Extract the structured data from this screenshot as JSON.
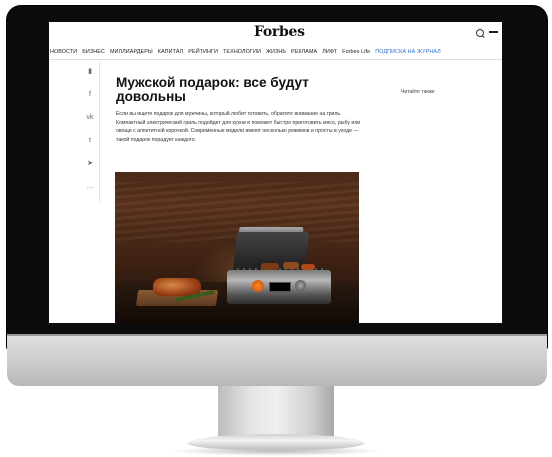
{
  "site": {
    "logo": "Forbes"
  },
  "nav": {
    "items": [
      "НОВОСТИ",
      "БИЗНЕС",
      "МИЛЛИАРДЕРЫ",
      "КАПИТАЛ",
      "РЕЙТИНГИ",
      "ТЕХНОЛОГИИ",
      "ЖИЗНЬ",
      "РЕКЛАМА",
      "ЛИФТ"
    ],
    "special": "Forbes Life",
    "link": "ПОДПИСКА НА ЖУРНАЛ"
  },
  "share_icons": [
    "bookmark-icon",
    "facebook-icon",
    "vk-icon",
    "twitter-icon",
    "telegram-icon",
    "more-icon"
  ],
  "share_glyphs": [
    "▮",
    "f",
    "vk",
    "t",
    "➤",
    "…"
  ],
  "article": {
    "title": "Мужской подарок: все будут довольны",
    "lead": "Если вы ищете подарок для мужчины, который любит готовить, обратите внимание на гриль. Компактный электрический гриль подойдет для кухни и поможет быстро приготовить мясо, рыбу или овощи с аппетитной корочкой. Современные модели имеют несколько режимов и просты в уходе — такой подарок порадует каждого.",
    "image_alt": "electric grill with food on a wooden counter"
  },
  "sidebar": {
    "label": "Читайте также"
  },
  "colors": {
    "link": "#2f6fc9",
    "bezel": "#0c0c0c"
  }
}
